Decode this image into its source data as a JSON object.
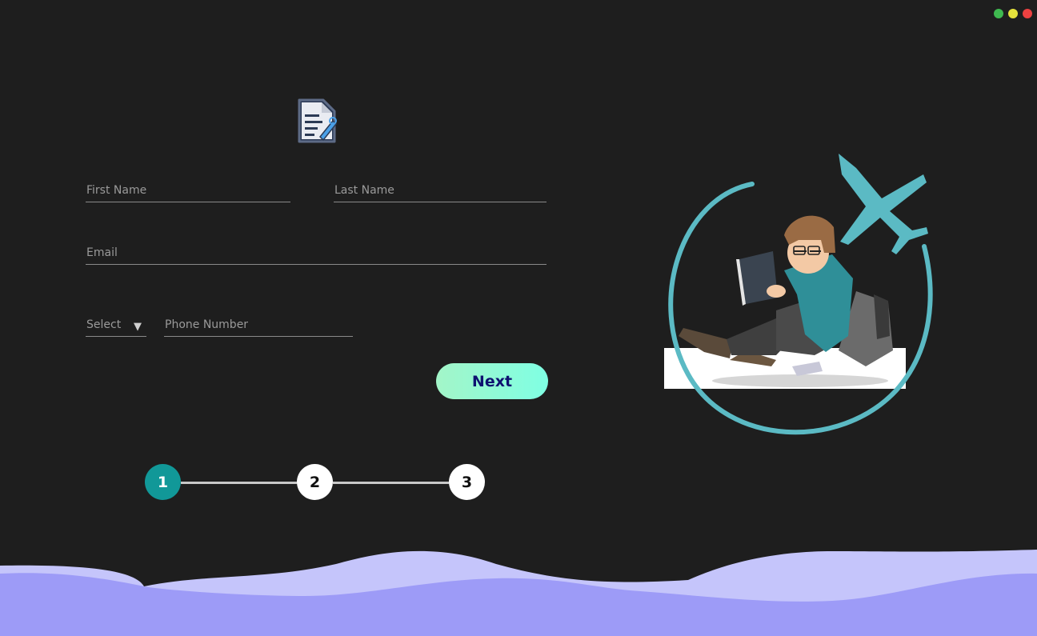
{
  "window_controls": {
    "colors": [
      "#3fb950",
      "#e5e23c",
      "#ec4141"
    ],
    "names": [
      "maximize",
      "minimize",
      "close"
    ]
  },
  "form": {
    "icon": "document-edit-icon",
    "first_name_placeholder": "First Name",
    "last_name_placeholder": "Last Name",
    "email_placeholder": "Email",
    "country_code_label": "Select",
    "country_code_arrow": "▼",
    "phone_placeholder": "Phone Number",
    "next_label": "Next"
  },
  "stepper": {
    "steps": [
      "1",
      "2",
      "3"
    ],
    "active_step": 1
  },
  "illustration": {
    "name": "student-reading-travel-illustration",
    "accent": "#5bbac4"
  },
  "colors": {
    "background": "#1e1e1e",
    "accent_teal": "#119898",
    "button_gradient_start": "#a3f5c8",
    "button_gradient_end": "#7fffe3",
    "wave_light": "#c5c5fb",
    "wave_dark": "#9d9bf7"
  }
}
